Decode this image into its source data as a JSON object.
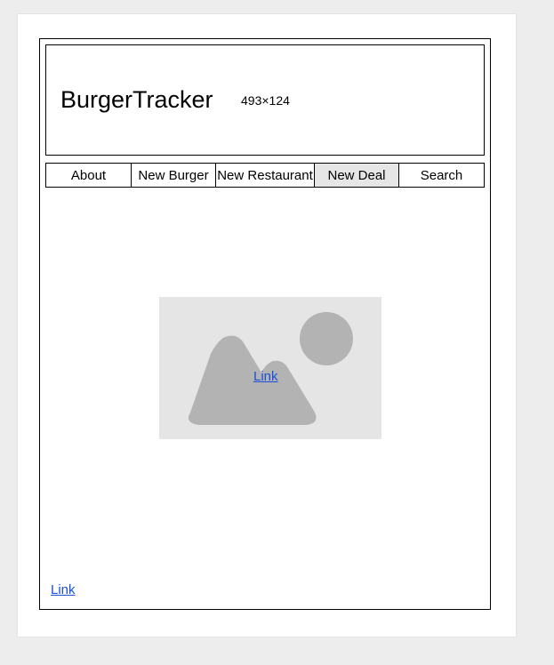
{
  "header": {
    "title": "BurgerTracker",
    "dimensions_label": "493×124"
  },
  "nav": {
    "items": [
      {
        "label": "About",
        "active": false
      },
      {
        "label": "New Burger",
        "active": false
      },
      {
        "label": "New Restaurant",
        "active": false
      },
      {
        "label": "New Deal",
        "active": true
      },
      {
        "label": "Search",
        "active": false
      }
    ]
  },
  "main": {
    "image_icon": "image-placeholder-icon",
    "center_link": "Link"
  },
  "footer": {
    "link": "Link"
  },
  "colors": {
    "page_background": "#ededed",
    "placeholder_background": "#e5e5e5",
    "placeholder_shapes": "#b3b3b3",
    "active_nav": "#e6e6e6",
    "link": "#1a4fd8"
  }
}
